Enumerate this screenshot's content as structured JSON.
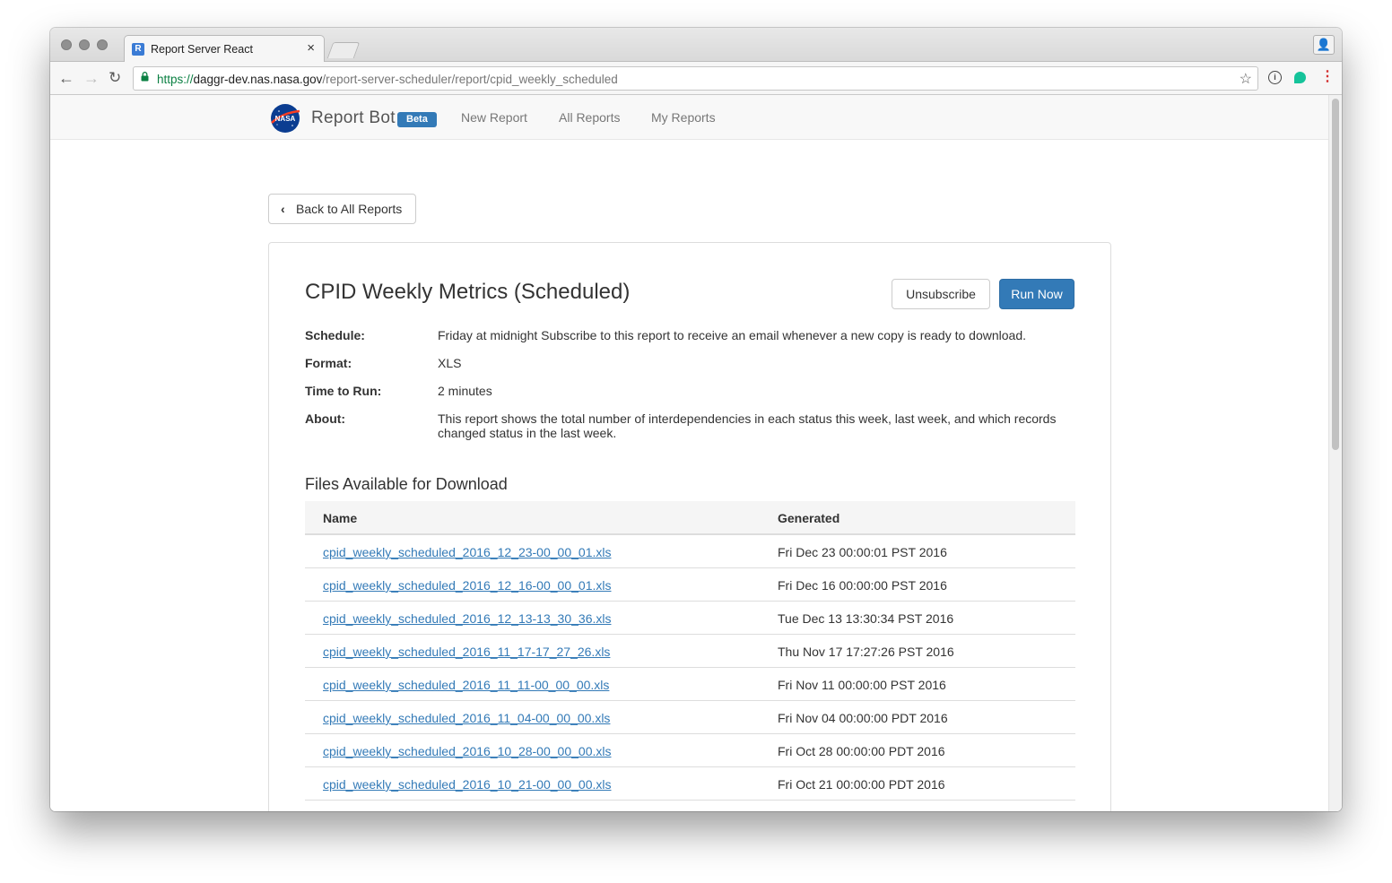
{
  "browser": {
    "tab_title": "Report Server React",
    "tab_favicon_letter": "R",
    "tab_close": "×",
    "url_scheme": "https://",
    "url_host": "daggr-dev.nas.nasa.gov",
    "url_path": "/report-server-scheduler/report/cpid_weekly_scheduled",
    "nav_back": "←",
    "nav_forward": "→",
    "nav_reload": "↻",
    "star": "☆",
    "ext_icon": "i",
    "menu": "⋮",
    "profile": "👤"
  },
  "app": {
    "logo_text": "NASA",
    "brand": "Report Bot",
    "badge": "Beta",
    "nav": [
      "New Report",
      "All Reports",
      "My Reports"
    ]
  },
  "page": {
    "back_button": "Back to All Reports",
    "back_chevron": "‹",
    "title": "CPID Weekly Metrics (Scheduled)",
    "unsubscribe_button": "Unsubscribe",
    "run_now_button": "Run Now"
  },
  "details": [
    {
      "label": "Schedule:",
      "value": "Friday at midnight Subscribe to this report to receive an email whenever a new copy is ready to download."
    },
    {
      "label": "Format:",
      "value": "XLS"
    },
    {
      "label": "Time to Run:",
      "value": "2 minutes"
    },
    {
      "label": "About:",
      "value": "This report shows the total number of interdependencies in each status this week, last week, and which records changed status in the last week."
    }
  ],
  "files": {
    "section_title": "Files Available for Download",
    "headers": {
      "name": "Name",
      "generated": "Generated"
    },
    "rows": [
      {
        "name": "cpid_weekly_scheduled_2016_12_23-00_00_01.xls",
        "generated": "Fri Dec 23 00:00:01 PST 2016"
      },
      {
        "name": "cpid_weekly_scheduled_2016_12_16-00_00_01.xls",
        "generated": "Fri Dec 16 00:00:00 PST 2016"
      },
      {
        "name": "cpid_weekly_scheduled_2016_12_13-13_30_36.xls",
        "generated": "Tue Dec 13 13:30:34 PST 2016"
      },
      {
        "name": "cpid_weekly_scheduled_2016_11_17-17_27_26.xls",
        "generated": "Thu Nov 17 17:27:26 PST 2016"
      },
      {
        "name": "cpid_weekly_scheduled_2016_11_11-00_00_00.xls",
        "generated": "Fri Nov 11 00:00:00 PST 2016"
      },
      {
        "name": "cpid_weekly_scheduled_2016_11_04-00_00_00.xls",
        "generated": "Fri Nov 04 00:00:00 PDT 2016"
      },
      {
        "name": "cpid_weekly_scheduled_2016_10_28-00_00_00.xls",
        "generated": "Fri Oct 28 00:00:00 PDT 2016"
      },
      {
        "name": "cpid_weekly_scheduled_2016_10_21-00_00_00.xls",
        "generated": "Fri Oct 21 00:00:00 PDT 2016"
      }
    ]
  },
  "colors": {
    "primary": "#337ab7",
    "secure_green": "#0b8043",
    "link": "#337ab7"
  }
}
